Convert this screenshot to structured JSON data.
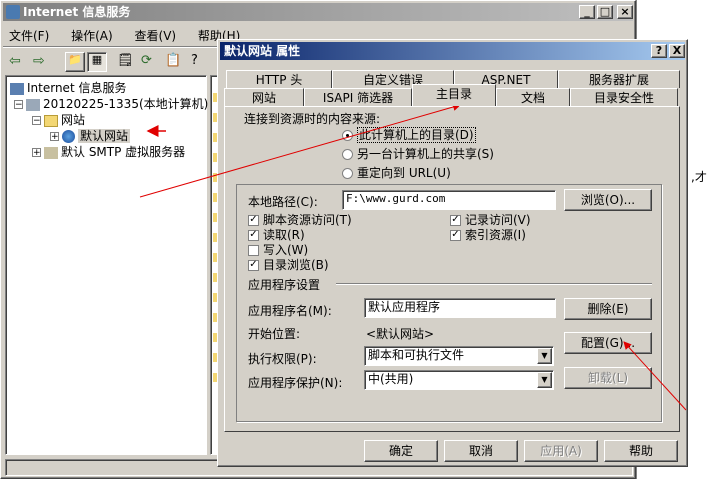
{
  "main_window": {
    "title": "Internet 信息服务",
    "menu": [
      "文件(F)",
      "操作(A)",
      "查看(V)",
      "帮助(H)"
    ],
    "tree": {
      "root": "Internet 信息服务",
      "computer": "20120225-1335(本地计算机)",
      "sites_folder": "网站",
      "default_site": "默认网站",
      "smtp": "默认 SMTP 虚拟服务器"
    },
    "right_edge_text": ",才"
  },
  "dialog": {
    "title": "默认网站 属性",
    "help_btn": "?",
    "close_btn": "X",
    "tabs_row1": [
      "HTTP 头",
      "自定义错误",
      "ASP.NET",
      "服务器扩展"
    ],
    "tabs_row2": [
      "网站",
      "ISAPI 筛选器",
      "主目录",
      "文档",
      "目录安全性"
    ],
    "content_source_label": "连接到资源时的内容来源:",
    "radio_options": [
      "此计算机上的目录(D)",
      "另一台计算机上的共享(S)",
      "重定向到 URL(U)"
    ],
    "local_path_label": "本地路径(C):",
    "local_path_value": "F:\\www.gurd.com",
    "browse_btn": "浏览(O)...",
    "checkboxes_left": [
      {
        "label": "脚本资源访问(T)",
        "checked": true
      },
      {
        "label": "读取(R)",
        "checked": true
      },
      {
        "label": "写入(W)",
        "checked": false
      },
      {
        "label": "目录浏览(B)",
        "checked": true
      }
    ],
    "checkboxes_right": [
      {
        "label": "记录访问(V)",
        "checked": true
      },
      {
        "label": "索引资源(I)",
        "checked": true
      }
    ],
    "app_settings_label": "应用程序设置",
    "app_name_label": "应用程序名(M):",
    "app_name_value": "默认应用程序",
    "remove_btn": "删除(E)",
    "start_label": "开始位置:",
    "start_value": "<默认网站>",
    "config_btn": "配置(G)...",
    "exec_label": "执行权限(P):",
    "exec_value": "脚本和可执行文件",
    "protect_label": "应用程序保护(N):",
    "protect_value": "中(共用)",
    "unload_btn": "卸载(L)",
    "ok_btn": "确定",
    "cancel_btn": "取消",
    "apply_btn": "应用(A)",
    "help_footer_btn": "帮助"
  },
  "colors": {
    "annotation_red": "#e00000",
    "active_title": "#0a246a",
    "inactive_title": "#808080"
  }
}
